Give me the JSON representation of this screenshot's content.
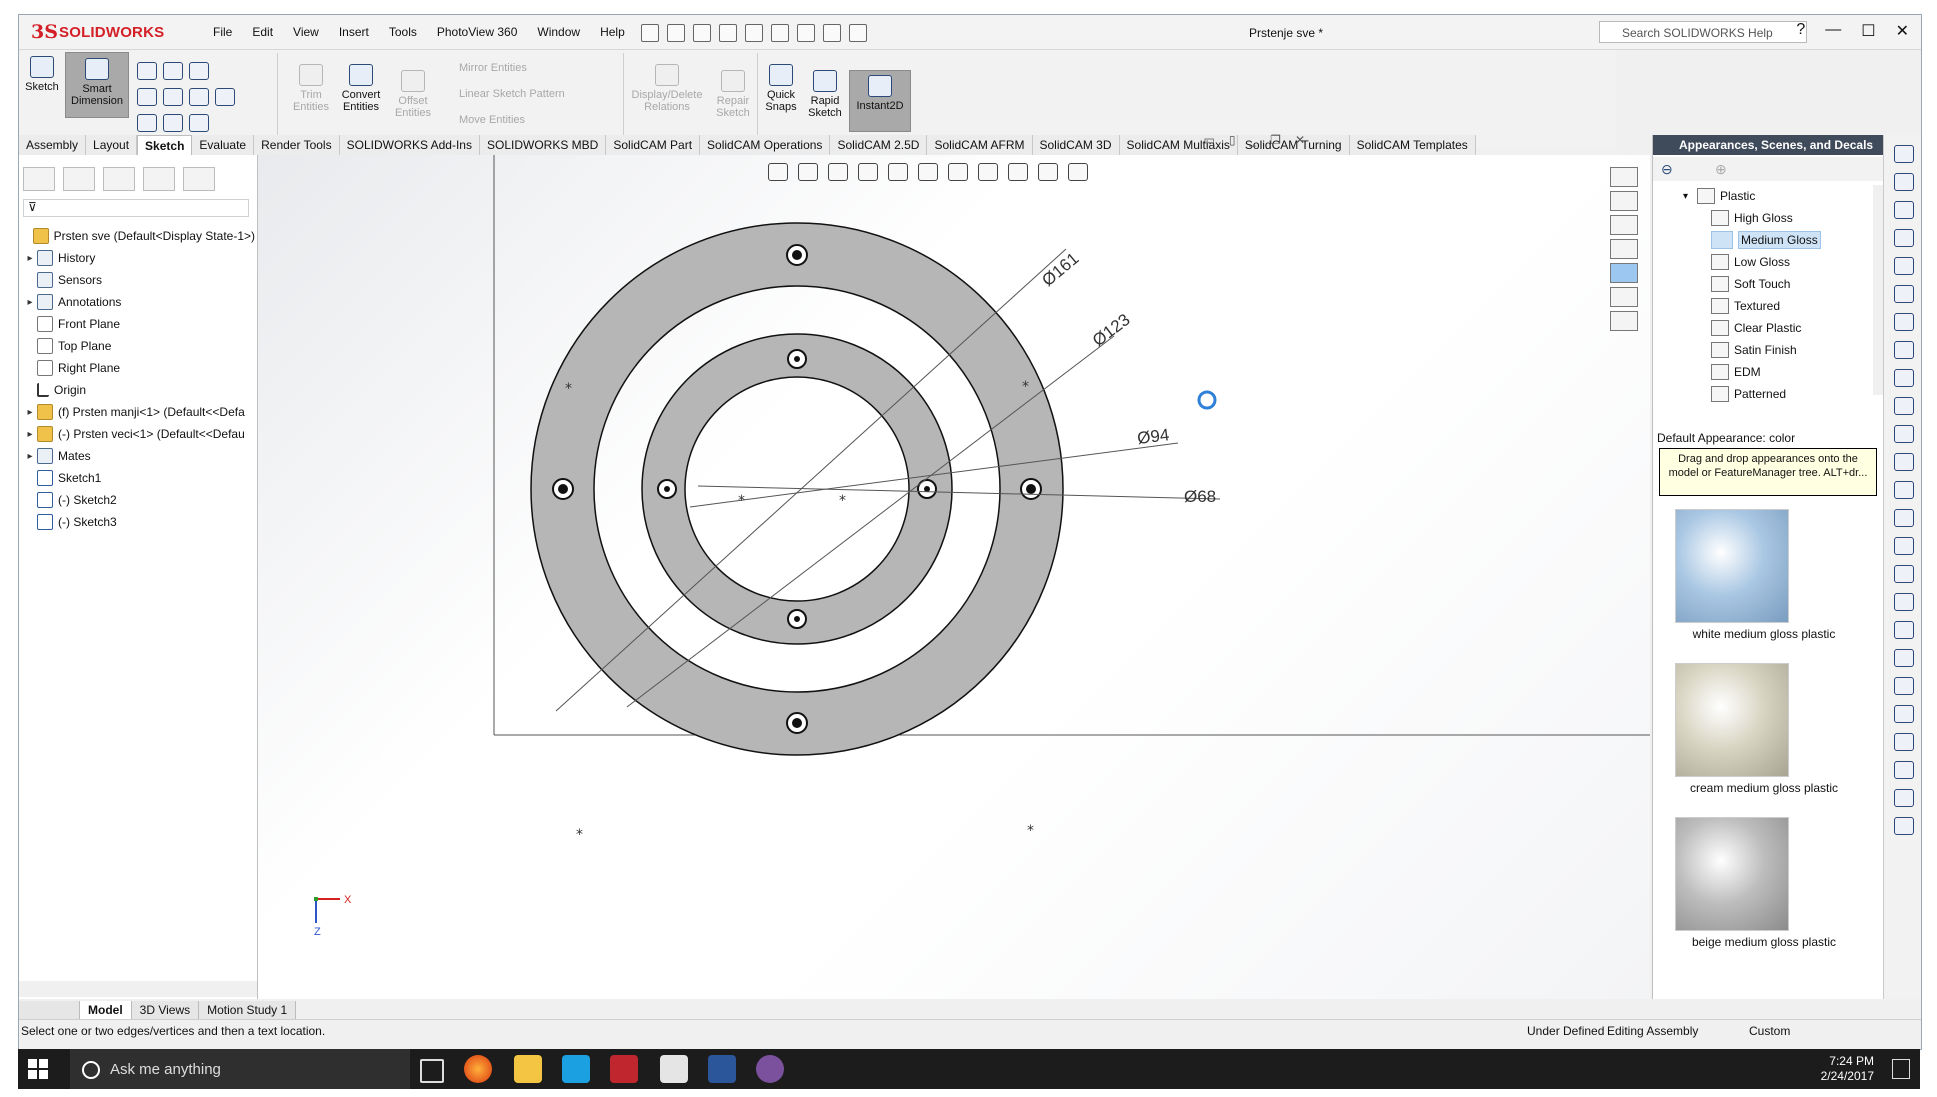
{
  "app": {
    "brand": "SOLIDWORKS",
    "ds": "3S",
    "title": "Prstenje sve *"
  },
  "menu": [
    "File",
    "Edit",
    "View",
    "Insert",
    "Tools",
    "PhotoView 360",
    "Window",
    "Help"
  ],
  "help_search": {
    "placeholder": "Search SOLIDWORKS Help"
  },
  "window_buttons": {
    "help": "?",
    "min": "—",
    "max": "☐",
    "close": "✕"
  },
  "toolbar": {
    "sketch": "Sketch",
    "smart_dimension": [
      "Smart",
      "Dimension"
    ],
    "trim": [
      "Trim",
      "Entities"
    ],
    "convert": [
      "Convert",
      "Entities"
    ],
    "offset": [
      "Offset",
      "Entities"
    ],
    "mirror": "Mirror Entities",
    "linear_pattern": "Linear Sketch Pattern",
    "move": "Move Entities",
    "display_delete": [
      "Display/Delete",
      "Relations"
    ],
    "repair": [
      "Repair",
      "Sketch"
    ],
    "quick_snaps": [
      "Quick",
      "Snaps"
    ],
    "rapid_sketch": [
      "Rapid",
      "Sketch"
    ],
    "instant2d": "Instant2D"
  },
  "tabs": [
    "Assembly",
    "Layout",
    "Sketch",
    "Evaluate",
    "Render Tools",
    "SOLIDWORKS Add-Ins",
    "SOLIDWORKS MBD",
    "SolidCAM Part",
    "SolidCAM Operations",
    "SolidCAM 2.5D",
    "SolidCAM AFRM",
    "SolidCAM 3D",
    "SolidCAM Multiaxis",
    "SolidCAM Turning",
    "SolidCAM Templates"
  ],
  "feature_tree": [
    {
      "label": "Prsten sve  (Default<Display State-1>)",
      "exp": "",
      "icon": "asm"
    },
    {
      "label": "History",
      "exp": "▸",
      "icon": "fold"
    },
    {
      "label": "Sensors",
      "exp": "",
      "icon": "fold"
    },
    {
      "label": "Annotations",
      "exp": "▸",
      "icon": "fold"
    },
    {
      "label": "Front Plane",
      "exp": "",
      "icon": "pl"
    },
    {
      "label": "Top Plane",
      "exp": "",
      "icon": "pl"
    },
    {
      "label": "Right Plane",
      "exp": "",
      "icon": "pl"
    },
    {
      "label": "Origin",
      "exp": "",
      "icon": "org"
    },
    {
      "label": "(f) Prsten manji<1> (Default<<Defa",
      "exp": "▸",
      "icon": "asm"
    },
    {
      "label": "(-) Prsten veci<1> (Default<<Defau",
      "exp": "▸",
      "icon": "asm"
    },
    {
      "label": "Mates",
      "exp": "▸",
      "icon": "fold"
    },
    {
      "label": "Sketch1",
      "exp": "",
      "icon": "sk"
    },
    {
      "label": "(-) Sketch2",
      "exp": "",
      "icon": "sk"
    },
    {
      "label": "(-) Sketch3",
      "exp": "",
      "icon": "sk"
    }
  ],
  "dimensions": {
    "d161": "Ø161",
    "d123": "Ø123",
    "d94": "Ø94",
    "d68": "Ø68"
  },
  "axes": {
    "x": "X",
    "z": "Z"
  },
  "appearances": {
    "header": "Appearances, Scenes, and Decals",
    "folder": "Plastic",
    "items": [
      "High Gloss",
      "Medium Gloss",
      "Low Gloss",
      "Soft Touch",
      "Textured",
      "Clear Plastic",
      "Satin Finish",
      "EDM",
      "Patterned"
    ],
    "selected": "Medium Gloss",
    "default_appearance": "Default Appearance: color",
    "tip": "Drag and drop appearances onto the model or FeatureManager tree.  ALT+dr...",
    "thumbs": [
      "white medium gloss plastic",
      "cream medium gloss plastic",
      "beige medium gloss plastic"
    ]
  },
  "bottom_tabs": [
    "Model",
    "3D Views",
    "Motion Study 1"
  ],
  "status": {
    "message": "Select one or two edges/vertices and then a text location.",
    "under_defined": "Under Defined",
    "editing": "Editing Assembly",
    "custom": "Custom"
  },
  "taskbar": {
    "search": "Ask me anything",
    "time": "7:24 PM",
    "date": "2/24/2017"
  }
}
